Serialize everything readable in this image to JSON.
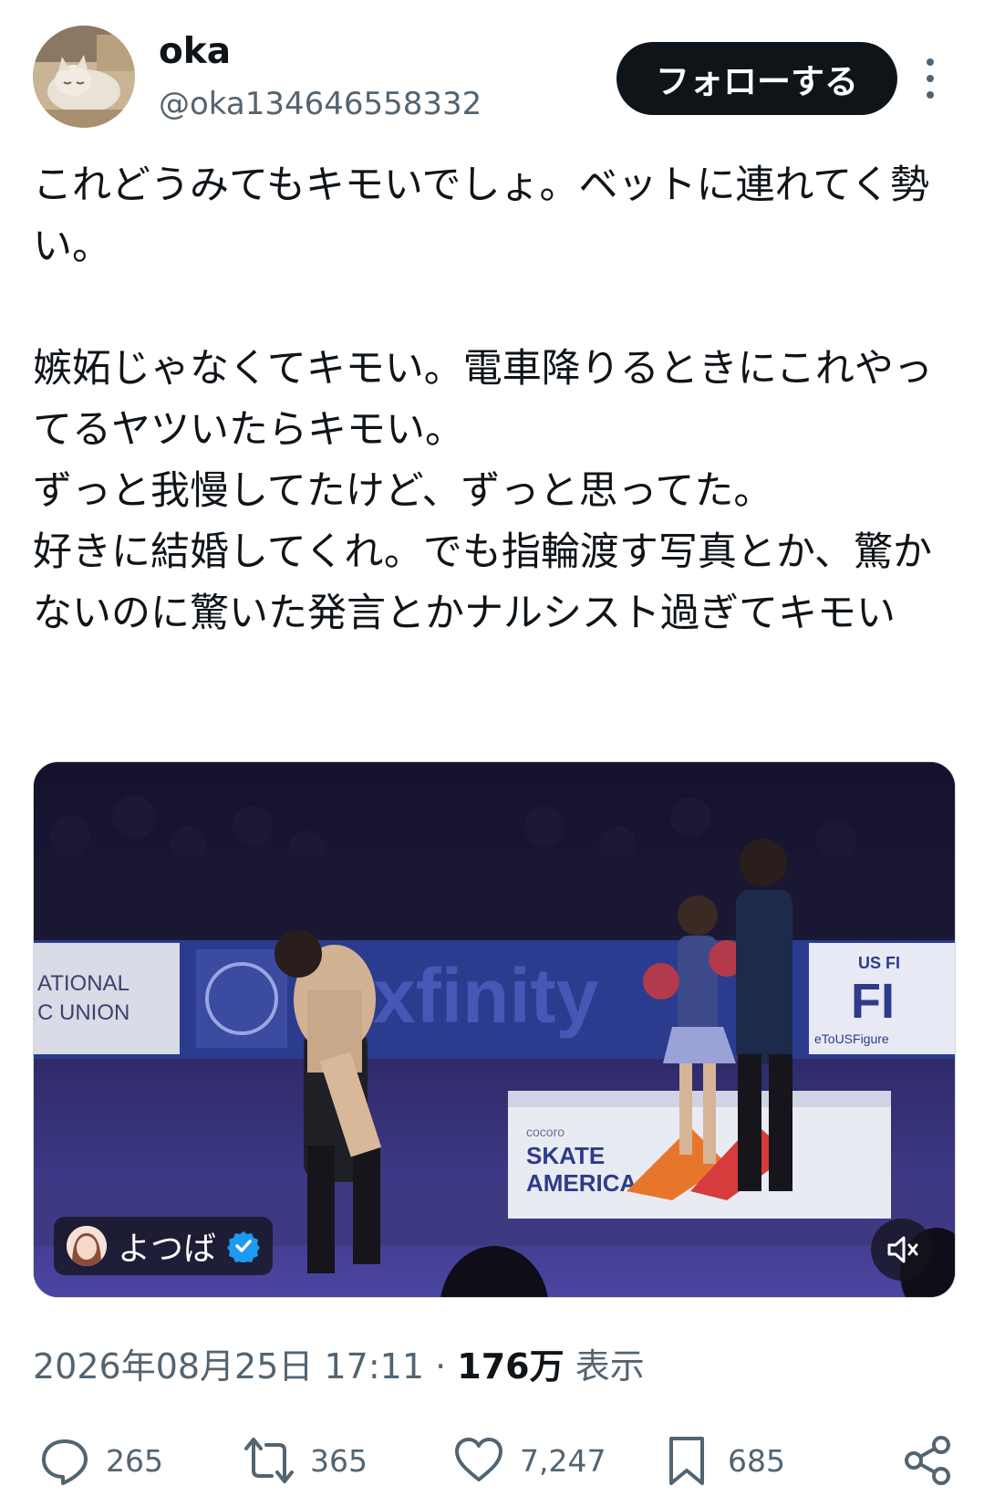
{
  "author": {
    "name": "oka",
    "handle": "@oka134646558332",
    "avatar_icon": "cat-avatar"
  },
  "follow_label": "フォローする",
  "tweet_text": "これどうみてもキモいでしょ。ベットに連れてく勢い。\n\n嫉妬じゃなくてキモい。電車降りるときにこれやってるヤツいたらキモい。\nずっと我慢してたけど、ずっと思ってた。\n好きに結婚してくれ。でも指輪渡す写真とか、驚かないのに驚いた発言とかナルシスト過ぎてキモい",
  "media": {
    "uploader_name": "よつば",
    "verified": true,
    "mute_icon": "speaker-muted-icon",
    "scene_text": {
      "sponsor": "xfinity",
      "banner_left_1": "ATIONAL",
      "banner_left_2": "C UNION",
      "banner_right": "FI",
      "banner_right_top": "US FI",
      "banner_right_small": "eToUSFigure",
      "podium_small": "cocoro",
      "podium_1": "SKATE",
      "podium_2": "AMERICA"
    }
  },
  "meta": {
    "datetime": "2026年08月25日 17:11",
    "separator": "·",
    "views_count": "176万",
    "views_label": "表示"
  },
  "actions": {
    "replies": "265",
    "reposts": "365",
    "likes": "7,247",
    "bookmarks": "685"
  },
  "colors": {
    "text": "#0f1419",
    "secondary": "#536471",
    "verified": "#1d9bf0"
  }
}
